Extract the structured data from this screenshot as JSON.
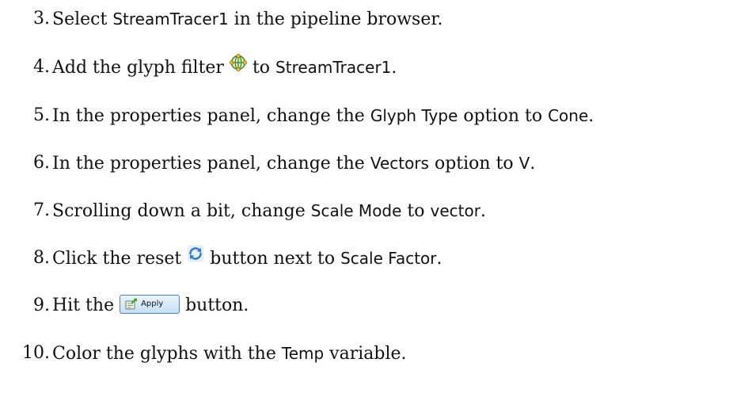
{
  "steps": [
    {
      "num": "3.",
      "parts": [
        "Select ",
        "StreamTracer1",
        " in the pipeline browser."
      ]
    },
    {
      "num": "4.",
      "parts": [
        "Add the glyph filter ",
        "",
        " to ",
        "StreamTracer1",
        "."
      ],
      "icon": "glyph-filter-icon"
    },
    {
      "num": "5.",
      "parts": [
        "In the properties panel, change the ",
        "Glyph Type",
        " option to ",
        "Cone",
        "."
      ]
    },
    {
      "num": "6.",
      "parts": [
        "In the properties panel, change the ",
        "Vectors",
        " option to ",
        "V",
        "."
      ]
    },
    {
      "num": "7.",
      "parts": [
        "Scrolling down a bit, change ",
        "Scale Mode",
        " to ",
        "vector",
        "."
      ]
    },
    {
      "num": "8.",
      "parts": [
        "Click the reset ",
        "",
        " button next to ",
        "Scale Factor",
        "."
      ],
      "icon": "reset-icon"
    },
    {
      "num": "9.",
      "parts": [
        "Hit the ",
        "",
        " button."
      ],
      "button_label": "Apply"
    },
    {
      "num": "10.",
      "parts": [
        "Color the glyphs with the ",
        "Temp",
        " variable."
      ]
    }
  ]
}
